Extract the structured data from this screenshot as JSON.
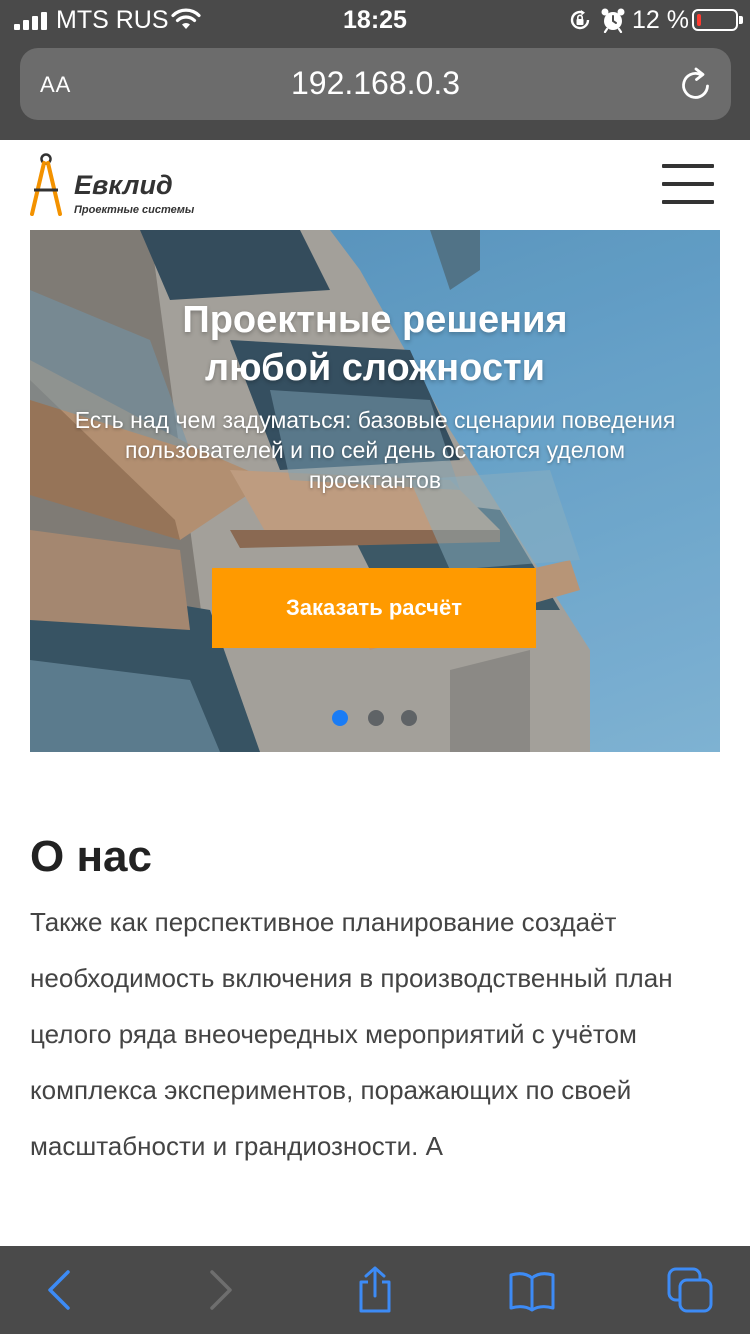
{
  "status_bar": {
    "carrier": "MTS RUS",
    "time": "18:25",
    "battery_percent": "12 %",
    "battery_level": 0.12,
    "icons": [
      "signal-icon",
      "wifi-icon",
      "rotation-lock-icon",
      "alarm-icon",
      "battery-icon"
    ]
  },
  "browser": {
    "text_size_label": "AA",
    "url": "192.168.0.3",
    "icons": [
      "reload-icon"
    ]
  },
  "header": {
    "logo_name": "Евклид",
    "logo_subtitle": "Проектные системы",
    "icons": [
      "compass-logo-icon",
      "burger-menu-icon"
    ]
  },
  "hero": {
    "title_line1": "Проектные решения",
    "title_line2": "любой сложности",
    "text": "Есть над чем задуматься: базовые сценарии поведения пользователей и по сей день остаются уделом проектантов",
    "cta_label": "Заказать расчёт",
    "slides_total": 3,
    "active_slide": 1
  },
  "about": {
    "title": "О нас",
    "text": "Также как перспективное планирование создаёт необходимость включения в производственный план целого ряда внеочередных мероприятий с учётом комплекса экспериментов, поражающих по своей масштабности и грандиозности. А"
  },
  "toolbar": {
    "icons": [
      "back-icon",
      "forward-icon",
      "share-icon",
      "bookmarks-icon",
      "tabs-icon"
    ]
  },
  "colors": {
    "chrome": "#4a4a4a",
    "address_bar": "#6c6c6c",
    "accent_orange": "#ff9a00",
    "ios_blue": "#1a7cf5",
    "battery_low": "#ff3b30"
  }
}
